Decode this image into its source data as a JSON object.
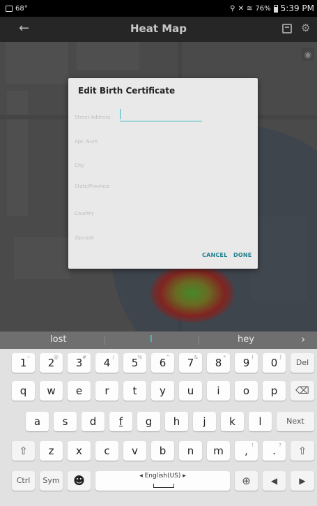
{
  "status": {
    "temp": "68°",
    "battery": "76%",
    "time": "5:39 PM"
  },
  "appbar": {
    "back_icon": "←",
    "title": "Heat Map"
  },
  "dialog": {
    "title": "Edit Birth Certificate",
    "fields": {
      "street": "Street Address",
      "apt": "Apt. Num",
      "city": "City",
      "state": "State/Province",
      "country": "Country",
      "zipcode": "Zipcode"
    },
    "cancel": "CANCEL",
    "done": "DONE"
  },
  "keyboard": {
    "suggestions": {
      "left": "lost",
      "middle": "I",
      "right": "hey",
      "arrow": "›"
    },
    "number_row": [
      {
        "k": "1",
        "s": "~"
      },
      {
        "k": "2",
        "s": "@"
      },
      {
        "k": "3",
        "s": "#"
      },
      {
        "k": "4",
        "s": "/"
      },
      {
        "k": "5",
        "s": "%"
      },
      {
        "k": "6",
        "s": "^"
      },
      {
        "k": "7",
        "s": "&"
      },
      {
        "k": "8",
        "s": "*"
      },
      {
        "k": "9",
        "s": "("
      },
      {
        "k": "0",
        "s": ")"
      }
    ],
    "del": "Del",
    "row_q": [
      "q",
      "w",
      "e",
      "r",
      "t",
      "y",
      "u",
      "i",
      "o",
      "p"
    ],
    "backspace": "⌫",
    "row_a": [
      "a",
      "s",
      "d",
      "f",
      "g",
      "h",
      "j",
      "k",
      "l"
    ],
    "next": "Next",
    "shift": "⇧",
    "row_z": [
      "z",
      "x",
      "c",
      "v",
      "b",
      "n",
      "m"
    ],
    "comma": ",",
    "comma_sup": "!",
    "period": ".",
    "period_sup": "?",
    "ctrl": "Ctrl",
    "sym": "Sym",
    "emoji": "☻",
    "space_label": "◂ English(US) ▸",
    "globe": "⊕",
    "left_arrow": "◀",
    "right_arrow": "▶"
  }
}
